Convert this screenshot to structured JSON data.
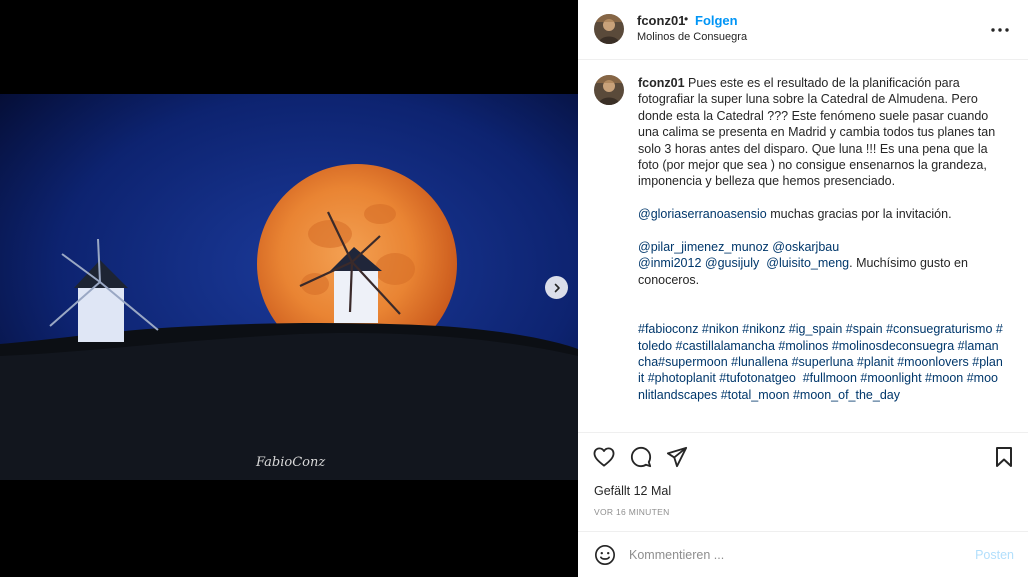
{
  "post": {
    "username": "fconz01",
    "separator": "•",
    "follow_label": "Folgen",
    "location": "Molinos de Consuegra",
    "watermark": "FabioConz"
  },
  "caption": {
    "username": "fconz01",
    "text1": " Pues este es el resultado de la planificación para fotografiar la super luna sobre la Catedral de Almudena. Pero donde esta la Catedral ??? Este fenómeno suele pasar cuando una calima se presenta en Madrid y cambia todos tus planes tan solo 3 horas antes del disparo. Que luna !!! Es una pena que la foto (por mejor que sea ) no consigue ensenarnos la grandeza, imponencia y belleza que hemos presenciado.\n\n",
    "mention_gloria": "@gloriaserranoasensio",
    "text2": " muchas gracias por la invitación.\n\n",
    "mention_pilar": "@pilar_jimenez_munoz",
    "sp1": " ",
    "mention_oskar": "@oskarjbau",
    "nl1": "\n",
    "mention_inmi": "@inmi2012",
    "sp2": " ",
    "mention_gusi": "@gusijuly",
    "sp3": "  ",
    "mention_luisito": "@luisito_meng",
    "text3": ". Muchísimo gusto en conoceros.\n\n\n",
    "hashtags": "#fabioconz #nikon #nikonz #ig_spain #spain #consuegraturismo #toledo #castillalamancha #molinos #molinosdeconsuegra #lamancha#supermoon #lunallena #superluna #planit #moonlovers #planit #photoplanit #tufotonatgeo  #fullmoon #moonlight #moon #moonlitlandscapes #total_moon #moon_of_the_day"
  },
  "stats": {
    "likes": "Gefällt 12 Mal",
    "time": "VOR 16 MINUTEN"
  },
  "comment": {
    "placeholder": "Kommentieren ...",
    "post_label": "Posten"
  },
  "icons": {
    "more": "more-options-icon",
    "next": "chevron-right-icon",
    "like": "heart-icon",
    "comment": "comment-icon",
    "share": "paper-plane-icon",
    "save": "bookmark-icon",
    "emoji": "emoji-icon"
  },
  "colors": {
    "follow": "#0095f6",
    "link": "#00376b",
    "post_disabled": "#b2dffc"
  }
}
